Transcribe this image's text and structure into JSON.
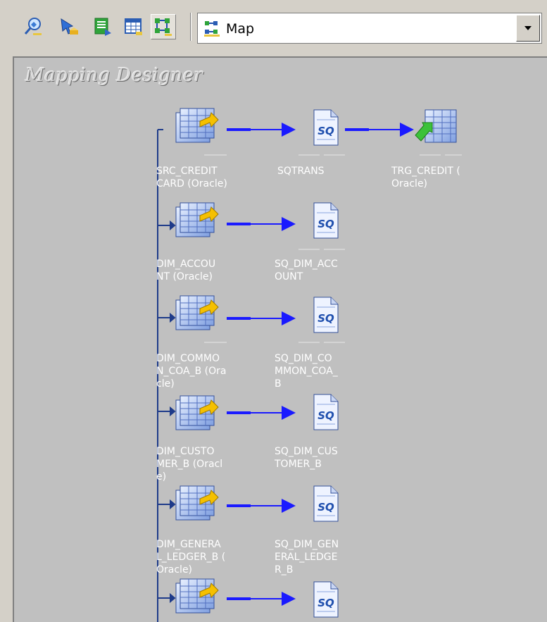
{
  "toolbar": {
    "buttons": [
      {
        "name": "source-analyzer-button",
        "icon": "source-analyzer-icon"
      },
      {
        "name": "target-designer-button",
        "icon": "target-designer-icon"
      },
      {
        "name": "transformation-developer-button",
        "icon": "transformation-developer-icon"
      },
      {
        "name": "mapplet-designer-button",
        "icon": "mapplet-designer-icon"
      },
      {
        "name": "mapping-designer-button",
        "icon": "mapping-designer-icon",
        "active": true
      }
    ],
    "view_select": {
      "selected": "Map",
      "icon": "map-icon"
    }
  },
  "canvas": {
    "title": "Mapping Designer",
    "rows": [
      {
        "source": "SRC_CREDIT\nCARD (Oracle)",
        "qualifier": "SQTRANS",
        "target": "TRG_CREDIT (\nOracle)"
      },
      {
        "source": "DIM_ACCOU\nNT (Oracle)",
        "qualifier": "SQ_DIM_ACC\nOUNT"
      },
      {
        "source": "DIM_COMMO\nN_COA_B (Ora\ncle)",
        "qualifier": "SQ_DIM_CO\nMMON_COA_\nB"
      },
      {
        "source": "DIM_CUSTO\nMER_B (Oracl\ne)",
        "qualifier": "SQ_DIM_CUS\nTOMER_B"
      },
      {
        "source": "DIM_GENERA\nL_LEDGER_B (\nOracle)",
        "qualifier": "SQ_DIM_GEN\nERAL_LEDGE\nR_B"
      },
      {
        "source": "",
        "qualifier": ""
      }
    ]
  },
  "colors": {
    "canvas_bg": "#c0c0c0",
    "link": "#1a1aff",
    "label": "#ffffff"
  }
}
